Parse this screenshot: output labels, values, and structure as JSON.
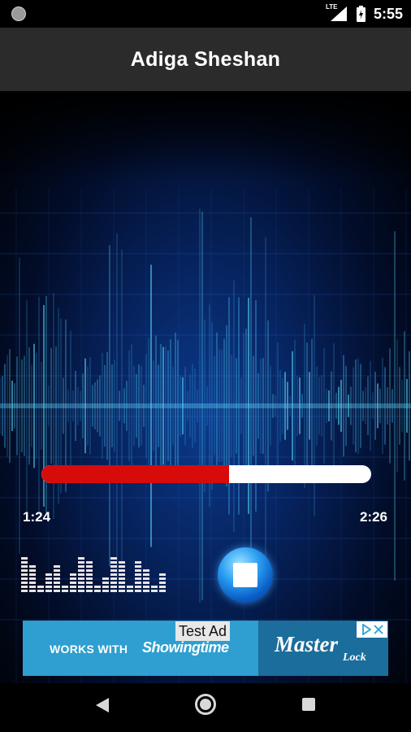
{
  "status_bar": {
    "network_label": "LTE",
    "time": "5:55",
    "icons": [
      "notification-dot-icon",
      "signal-icon",
      "battery-charging-icon"
    ]
  },
  "app_bar": {
    "title": "Adiga Sheshan"
  },
  "player": {
    "progress_fraction": 0.57,
    "elapsed": "1:24",
    "duration": "2:26",
    "colors": {
      "progress_fill": "#d80b0b",
      "progress_track": "#ffffff",
      "button_accent": "#2a9df2"
    },
    "equalizer_levels": [
      9,
      7,
      2,
      5,
      7,
      2,
      5,
      9,
      8,
      2,
      4,
      9,
      8,
      2,
      8,
      6,
      2,
      5
    ],
    "stop_button_icon": "stop-icon"
  },
  "ad": {
    "label": "Test Ad",
    "works_with": "WORKS WITH",
    "brand": "Showingtime",
    "master_text": "Master",
    "lock_text": "Lock",
    "colors": {
      "left": "#2e9fd0",
      "right": "#1b6d9b"
    },
    "icons": [
      "adchoices-icon",
      "close-icon"
    ]
  },
  "nav_bar": {
    "icons": [
      "back-icon",
      "home-icon",
      "recents-icon"
    ]
  }
}
